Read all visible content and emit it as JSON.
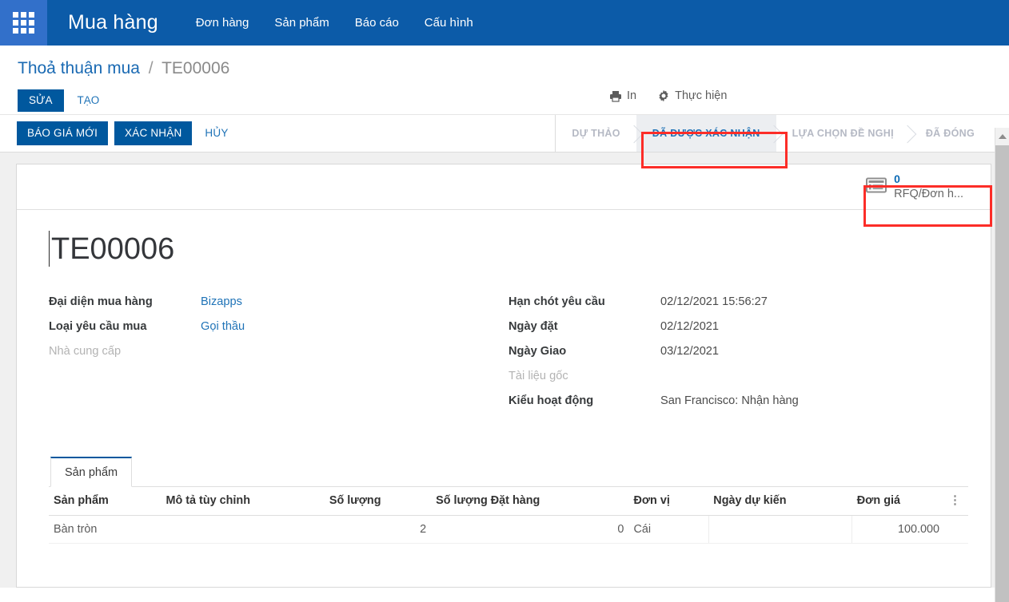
{
  "navbar": {
    "apps_icon": "apps-grid-icon",
    "brand": "Mua hàng",
    "menu": [
      {
        "label": "Đơn hàng"
      },
      {
        "label": "Sản phẩm"
      },
      {
        "label": "Báo cáo"
      },
      {
        "label": "Cấu hình"
      }
    ]
  },
  "control_panel": {
    "breadcrumb": {
      "root": "Thoả thuận mua",
      "separator": "/",
      "current": "TE00006"
    },
    "edit_label": "SỬA",
    "create_label": "TẠO",
    "tools": [
      {
        "icon": "printer-icon",
        "label": "In"
      },
      {
        "icon": "gear-icon",
        "label": "Thực hiện"
      }
    ]
  },
  "actions": {
    "new_quote_label": "BÁO GIÁ MỚI",
    "confirm_label": "XÁC NHẬN",
    "cancel_label": "HỦY"
  },
  "statusbar": {
    "items": [
      {
        "label": "DỰ THẢO",
        "active": false
      },
      {
        "label": "ĐÃ ĐƯỢC XÁC NHẬN",
        "active": true
      },
      {
        "label": "LỰA CHỌN ĐỀ NGHỊ",
        "active": false
      },
      {
        "label": "ĐÃ ĐÓNG",
        "active": false
      }
    ]
  },
  "stat_button": {
    "icon": "list-view-icon",
    "value": "0",
    "label": "RFQ/Đơn h..."
  },
  "record": {
    "title": "TE00006",
    "left_fields": [
      {
        "label": "Đại diện mua hàng",
        "value": "Bizapps",
        "style": "link",
        "empty": false
      },
      {
        "label": "Loại yêu cầu mua",
        "value": "Gọi thầu",
        "style": "link",
        "empty": false
      },
      {
        "label": "Nhà cung cấp",
        "value": "",
        "style": "text",
        "empty": true
      }
    ],
    "right_fields": [
      {
        "label": "Hạn chót yêu cầu",
        "value": "02/12/2021 15:56:27",
        "style": "text",
        "empty": false
      },
      {
        "label": "Ngày đặt",
        "value": "02/12/2021",
        "style": "text",
        "empty": false
      },
      {
        "label": "Ngày Giao",
        "value": "03/12/2021",
        "style": "text",
        "empty": false
      },
      {
        "label": "Tài liệu gốc",
        "value": "",
        "style": "text",
        "empty": true
      },
      {
        "label": "Kiểu hoạt động",
        "value": "San Francisco: Nhận hàng",
        "style": "text",
        "empty": false
      }
    ]
  },
  "notebook": {
    "tabs": [
      {
        "label": "Sản phẩm",
        "active": true
      }
    ],
    "table": {
      "columns": [
        {
          "label": "Sản phẩm",
          "align": "left"
        },
        {
          "label": "Mô tả tùy chỉnh",
          "align": "left"
        },
        {
          "label": "Số lượng",
          "align": "right"
        },
        {
          "label": "Số lượng Đặt hàng",
          "align": "right"
        },
        {
          "label": "Đơn vị",
          "align": "left"
        },
        {
          "label": "Ngày dự kiến",
          "align": "left"
        },
        {
          "label": "Đơn giá",
          "align": "right"
        }
      ],
      "optional_columns_icon": "vertical-dots-icon",
      "rows": [
        {
          "product": "Bàn tròn",
          "description": "",
          "quantity": "2",
          "ordered_quantity": "0",
          "uom": "Cái",
          "expected_date": "",
          "unit_price": "100.000"
        }
      ]
    }
  },
  "annotations": {
    "highlight_color": "#fc2d28",
    "boxes": [
      {
        "target": "status-confirmed"
      },
      {
        "target": "stat-button-rfq"
      }
    ]
  },
  "scrollbar": {
    "arrow_icon": "scroll-up-arrow-icon"
  }
}
